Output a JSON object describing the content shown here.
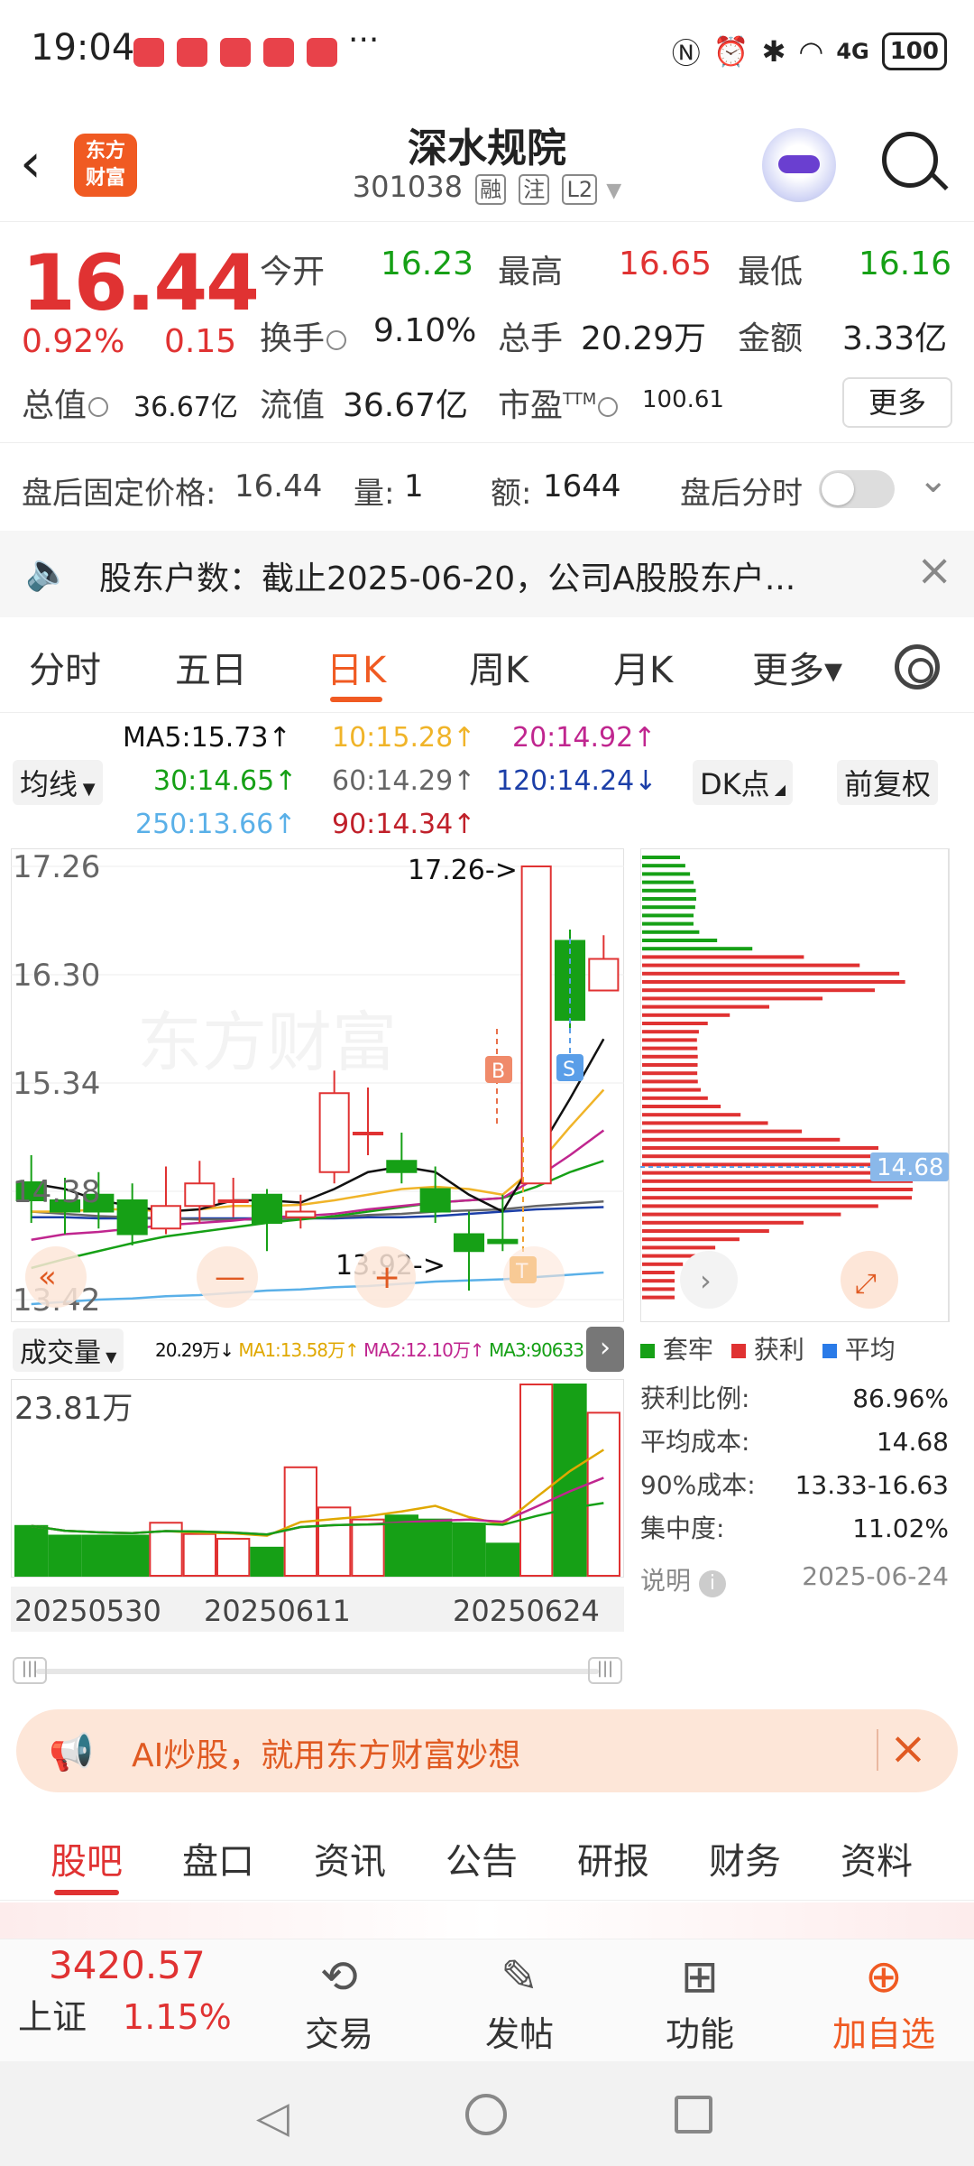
{
  "status": {
    "time": "19:04",
    "more": "···",
    "battery": "100",
    "net": "4G"
  },
  "header": {
    "title": "深水规院",
    "code": "301038",
    "tags": [
      "融",
      "注",
      "L2"
    ],
    "logo_line1": "东方",
    "logo_line2": "财富"
  },
  "quote": {
    "price": "16.44",
    "change_pct": "0.92%",
    "change": "0.15",
    "open_label": "今开",
    "open": "16.23",
    "high_label": "最高",
    "high": "16.65",
    "low_label": "最低",
    "low": "16.16",
    "turnover_label": "换手",
    "turnover": "9.10%",
    "vol_label": "总手",
    "vol": "20.29万",
    "amount_label": "金额",
    "amount": "3.33亿",
    "mcap_label": "总值",
    "mcap": "36.67亿",
    "float_label": "流值",
    "float": "36.67亿",
    "pe_label": "市盈",
    "pe_sup": "TTM",
    "pe": "100.61",
    "more_btn": "更多"
  },
  "after": {
    "price_label": "盘后固定价格:",
    "price": "16.44",
    "qty_label": "量:",
    "qty": "1",
    "amt_label": "额:",
    "amt": "1644",
    "fenshi_label": "盘后分时"
  },
  "notice": {
    "text": "股东户数：截止2025-06-20，公司A股股东户..."
  },
  "tabs": [
    "分时",
    "五日",
    "日K",
    "周K",
    "月K",
    "更多▾"
  ],
  "ma": {
    "ma5": "MA5:15.73↑",
    "ma10": "10:15.28↑",
    "ma20": "20:14.92↑",
    "ma30": "30:14.65↑",
    "ma60": "60:14.29↑",
    "ma120": "120:14.24↓",
    "ma250": "250:13.66↑",
    "ma90": "90:14.34↑",
    "junxian": "均线",
    "dk": "DK点",
    "fuquan": "前复权"
  },
  "colors": {
    "up": "#e03232",
    "down": "#16a016",
    "ma5": "#111111",
    "ma10": "#f0b429",
    "ma20": "#c0268f",
    "ma30": "#16a016",
    "ma60": "#666666",
    "ma120": "#1c3fa8",
    "ma250": "#5ab0e8",
    "ma90": "#c0202a",
    "accent": "#f05a22"
  },
  "chart_data": {
    "type": "candlestick",
    "y_ticks": [
      "17.26",
      "16.30",
      "15.34",
      "14.38",
      "13.42"
    ],
    "ylim": [
      13.42,
      17.26
    ],
    "annot_high": "17.26->",
    "annot_low": "13.92->",
    "buy_marker": "B",
    "sell_marker": "S",
    "t_marker": "T",
    "candles": [
      {
        "o": 14.46,
        "c": 14.3,
        "h": 14.7,
        "l": 14.1
      },
      {
        "o": 14.3,
        "c": 14.2,
        "h": 14.5,
        "l": 14.0
      },
      {
        "o": 14.35,
        "c": 14.2,
        "h": 14.55,
        "l": 14.05
      },
      {
        "o": 14.3,
        "c": 14.0,
        "h": 14.45,
        "l": 13.9
      },
      {
        "o": 14.05,
        "c": 14.25,
        "h": 14.6,
        "l": 14.0
      },
      {
        "o": 14.25,
        "c": 14.45,
        "h": 14.65,
        "l": 14.1
      },
      {
        "o": 14.3,
        "c": 14.3,
        "h": 14.5,
        "l": 14.15
      },
      {
        "o": 14.35,
        "c": 14.1,
        "h": 14.4,
        "l": 13.85
      },
      {
        "o": 14.15,
        "c": 14.2,
        "h": 14.35,
        "l": 14.05
      },
      {
        "o": 14.55,
        "c": 15.25,
        "h": 15.45,
        "l": 14.45
      },
      {
        "o": 14.9,
        "c": 14.9,
        "h": 15.3,
        "l": 14.7
      },
      {
        "o": 14.65,
        "c": 14.55,
        "h": 14.9,
        "l": 14.45
      },
      {
        "o": 14.4,
        "c": 14.2,
        "h": 14.6,
        "l": 14.1
      },
      {
        "o": 14.0,
        "c": 13.85,
        "h": 14.2,
        "l": 13.5
      },
      {
        "o": 13.95,
        "c": 13.92,
        "h": 14.35,
        "l": 13.85
      },
      {
        "o": 14.45,
        "c": 17.26,
        "h": 17.26,
        "l": 14.45
      },
      {
        "o": 16.6,
        "c": 15.9,
        "h": 16.7,
        "l": 15.8
      },
      {
        "o": 16.16,
        "c": 16.44,
        "h": 16.65,
        "l": 16.16
      }
    ],
    "ma5": [
      14.45,
      14.4,
      14.3,
      14.25,
      14.2,
      14.22,
      14.3,
      14.3,
      14.28,
      14.4,
      14.55,
      14.6,
      14.55,
      14.35,
      14.2,
      14.7,
      15.2,
      15.73
    ],
    "ma10": [
      14.2,
      14.2,
      14.22,
      14.22,
      14.2,
      14.22,
      14.25,
      14.25,
      14.26,
      14.3,
      14.35,
      14.4,
      14.42,
      14.4,
      14.35,
      14.6,
      14.95,
      15.28
    ],
    "ma20": [
      13.95,
      14.0,
      14.02,
      14.05,
      14.08,
      14.1,
      14.12,
      14.15,
      14.16,
      14.18,
      14.22,
      14.25,
      14.28,
      14.3,
      14.32,
      14.5,
      14.7,
      14.92
    ],
    "ma30": [
      13.7,
      13.78,
      13.85,
      13.92,
      13.98,
      14.02,
      14.06,
      14.1,
      14.13,
      14.16,
      14.2,
      14.24,
      14.28,
      14.3,
      14.32,
      14.42,
      14.55,
      14.65
    ],
    "ma60": [
      14.2,
      14.18,
      14.16,
      14.15,
      14.14,
      14.13,
      14.13,
      14.13,
      14.14,
      14.15,
      14.17,
      14.18,
      14.2,
      14.21,
      14.22,
      14.25,
      14.27,
      14.29
    ],
    "ma120": [
      14.15,
      14.15,
      14.14,
      14.14,
      14.14,
      14.14,
      14.14,
      14.14,
      14.14,
      14.14,
      14.15,
      14.15,
      14.16,
      14.18,
      14.2,
      14.22,
      14.23,
      14.24
    ],
    "ma250": [
      13.38,
      13.4,
      13.42,
      13.43,
      13.45,
      13.46,
      13.48,
      13.5,
      13.51,
      13.53,
      13.54,
      13.56,
      13.58,
      13.59,
      13.6,
      13.62,
      13.64,
      13.66
    ],
    "volume": {
      "label": "成交量",
      "max_label": "23.81万",
      "readout": "20.29万↓",
      "ma1": "MA1:13.58万↑",
      "ma2": "MA2:12.10万↑",
      "ma3": "MA3:90633↑",
      "max": 23.81,
      "values": [
        6.2,
        5.0,
        5.0,
        5.0,
        6.6,
        5.2,
        4.6,
        3.5,
        13.5,
        8.5,
        7.0,
        7.5,
        7.0,
        6.5,
        4.0,
        23.81,
        23.81,
        20.29
      ],
      "dates": [
        "20250530",
        "20250611",
        "20250624"
      ]
    }
  },
  "dist": {
    "avg_tag": "14.68",
    "legend": [
      "套牢",
      "获利",
      "平均"
    ],
    "rows": [
      {
        "k": "获利比例:",
        "v": "86.96%"
      },
      {
        "k": "平均成本:",
        "v": "14.68"
      },
      {
        "k": "90%成本:",
        "v": "13.33-16.63"
      },
      {
        "k": "集中度:",
        "v": "11.02%"
      }
    ],
    "note": "说明",
    "date": "2025-06-24"
  },
  "ai": {
    "text": "AI炒股，就用东方财富妙想"
  },
  "subtabs": [
    "股吧",
    "盘口",
    "资讯",
    "公告",
    "研报",
    "财务",
    "资料"
  ],
  "bottom": {
    "index_value": "3420.57",
    "index_name": "上证",
    "index_pct": "1.15%",
    "items": [
      "交易",
      "发帖",
      "功能",
      "加自选"
    ]
  }
}
